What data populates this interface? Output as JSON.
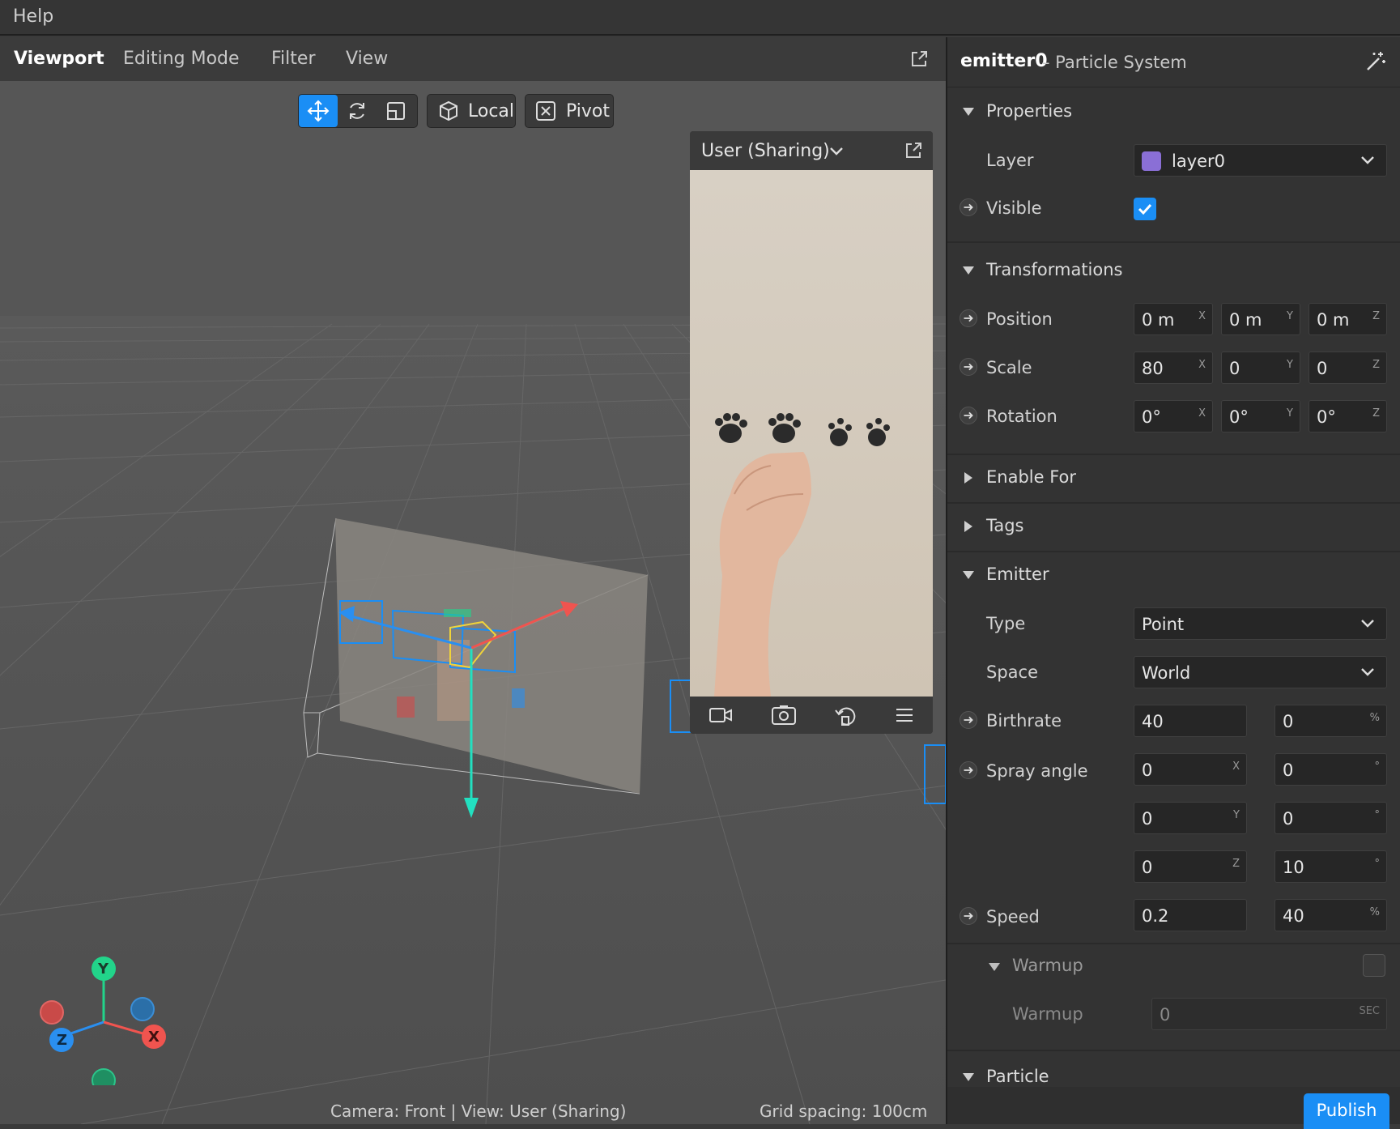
{
  "menubar": {
    "help": "Help"
  },
  "viewport": {
    "tabs": [
      "Viewport",
      "Editing Mode",
      "Filter",
      "View"
    ],
    "toolbar": {
      "local": "Local",
      "pivot": "Pivot"
    },
    "preview": {
      "title": "User (Sharing)"
    },
    "status": {
      "camera": "Camera: Front | View: User (Sharing)",
      "grid": "Grid spacing: 100cm"
    },
    "axes": {
      "y": "Y",
      "z": "Z",
      "x": "X"
    }
  },
  "panel": {
    "title": "emitter0",
    "subtitle": "– Particle System",
    "sections": {
      "properties": "Properties",
      "transformations": "Transformations",
      "enable_for": "Enable For",
      "tags": "Tags",
      "emitter": "Emitter",
      "warmup_group": "Warmup",
      "particle": "Particle"
    },
    "properties": {
      "layer_label": "Layer",
      "layer_value": "layer0",
      "layer_color": "#8a6fd6",
      "visible_label": "Visible",
      "visible_checked": true
    },
    "transformations": {
      "position_label": "Position",
      "position": [
        "0 m",
        "0 m",
        "0 m"
      ],
      "scale_label": "Scale",
      "scale": [
        "80",
        "0",
        "0"
      ],
      "rotation_label": "Rotation",
      "rotation": [
        "0°",
        "0°",
        "0°"
      ],
      "axes": [
        "X",
        "Y",
        "Z"
      ]
    },
    "emitter": {
      "type_label": "Type",
      "type_value": "Point",
      "space_label": "Space",
      "space_value": "World",
      "birthrate_label": "Birthrate",
      "birthrate": "40",
      "birthrate_var": "0",
      "spray_label": "Spray angle",
      "spray": [
        {
          "val": "0",
          "axis": "X",
          "var": "0"
        },
        {
          "val": "0",
          "axis": "Y",
          "var": "0"
        },
        {
          "val": "0",
          "axis": "Z",
          "var": "10"
        }
      ],
      "speed_label": "Speed",
      "speed": "0.2",
      "speed_var": "40",
      "percent": "%",
      "degree": "°",
      "warmup_label": "Warmup",
      "warmup_value": "0",
      "warmup_unit": "SEC"
    },
    "publish": "Publish"
  },
  "colors": {
    "accent": "#1a8ef5",
    "x_axis": "#f0544f",
    "y_axis": "#22d48a",
    "z_axis": "#2a8ff0"
  }
}
